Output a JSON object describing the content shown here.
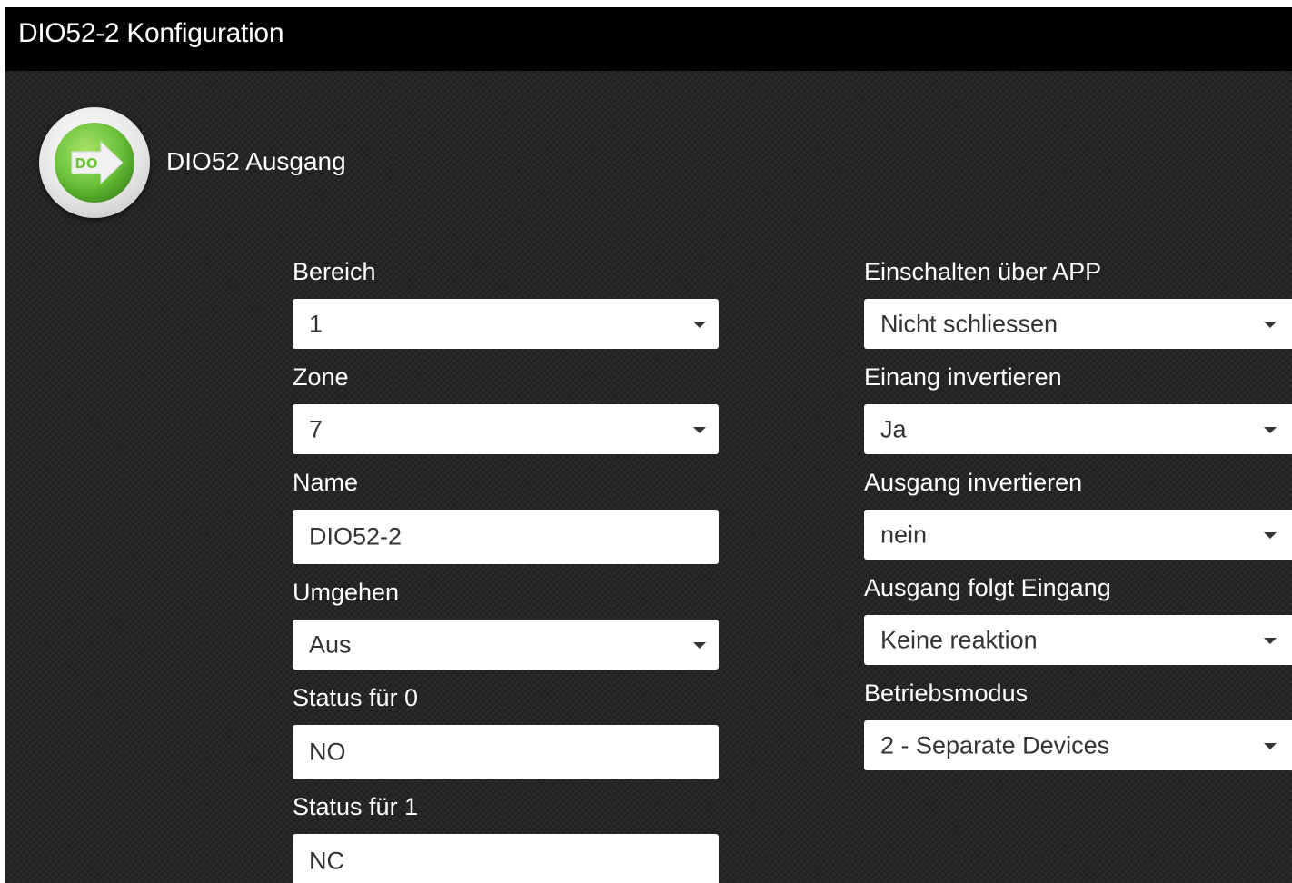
{
  "window": {
    "title": "DIO52-2 Konfiguration"
  },
  "device": {
    "icon": "do-arrow-icon",
    "icon_text": "DO",
    "label": "DIO52 Ausgang"
  },
  "left_fields": {
    "bereich": {
      "label": "Bereich",
      "value": "1"
    },
    "zone": {
      "label": "Zone",
      "value": "7"
    },
    "name": {
      "label": "Name",
      "value": "DIO52-2"
    },
    "umgehen": {
      "label": "Umgehen",
      "value": "Aus"
    },
    "status0": {
      "label": "Status für 0",
      "value": "NO"
    },
    "status1": {
      "label": "Status für 1",
      "value": "NC"
    }
  },
  "right_fields": {
    "einschalten": {
      "label": "Einschalten über APP",
      "value": "Nicht schliessen"
    },
    "einang": {
      "label": "Einang invertieren",
      "value": "Ja"
    },
    "ausgang_inv": {
      "label": "Ausgang invertieren",
      "value": "nein"
    },
    "ausgang_folgt": {
      "label": "Ausgang folgt Eingang",
      "value": "Keine reaktion"
    },
    "betriebsmodus": {
      "label": "Betriebsmodus",
      "value": "2 - Separate Devices"
    }
  },
  "colors": {
    "titlebar": "#000000",
    "background": "#262626",
    "icon_green": "#6cc33a",
    "control_bg": "#ffffff"
  }
}
